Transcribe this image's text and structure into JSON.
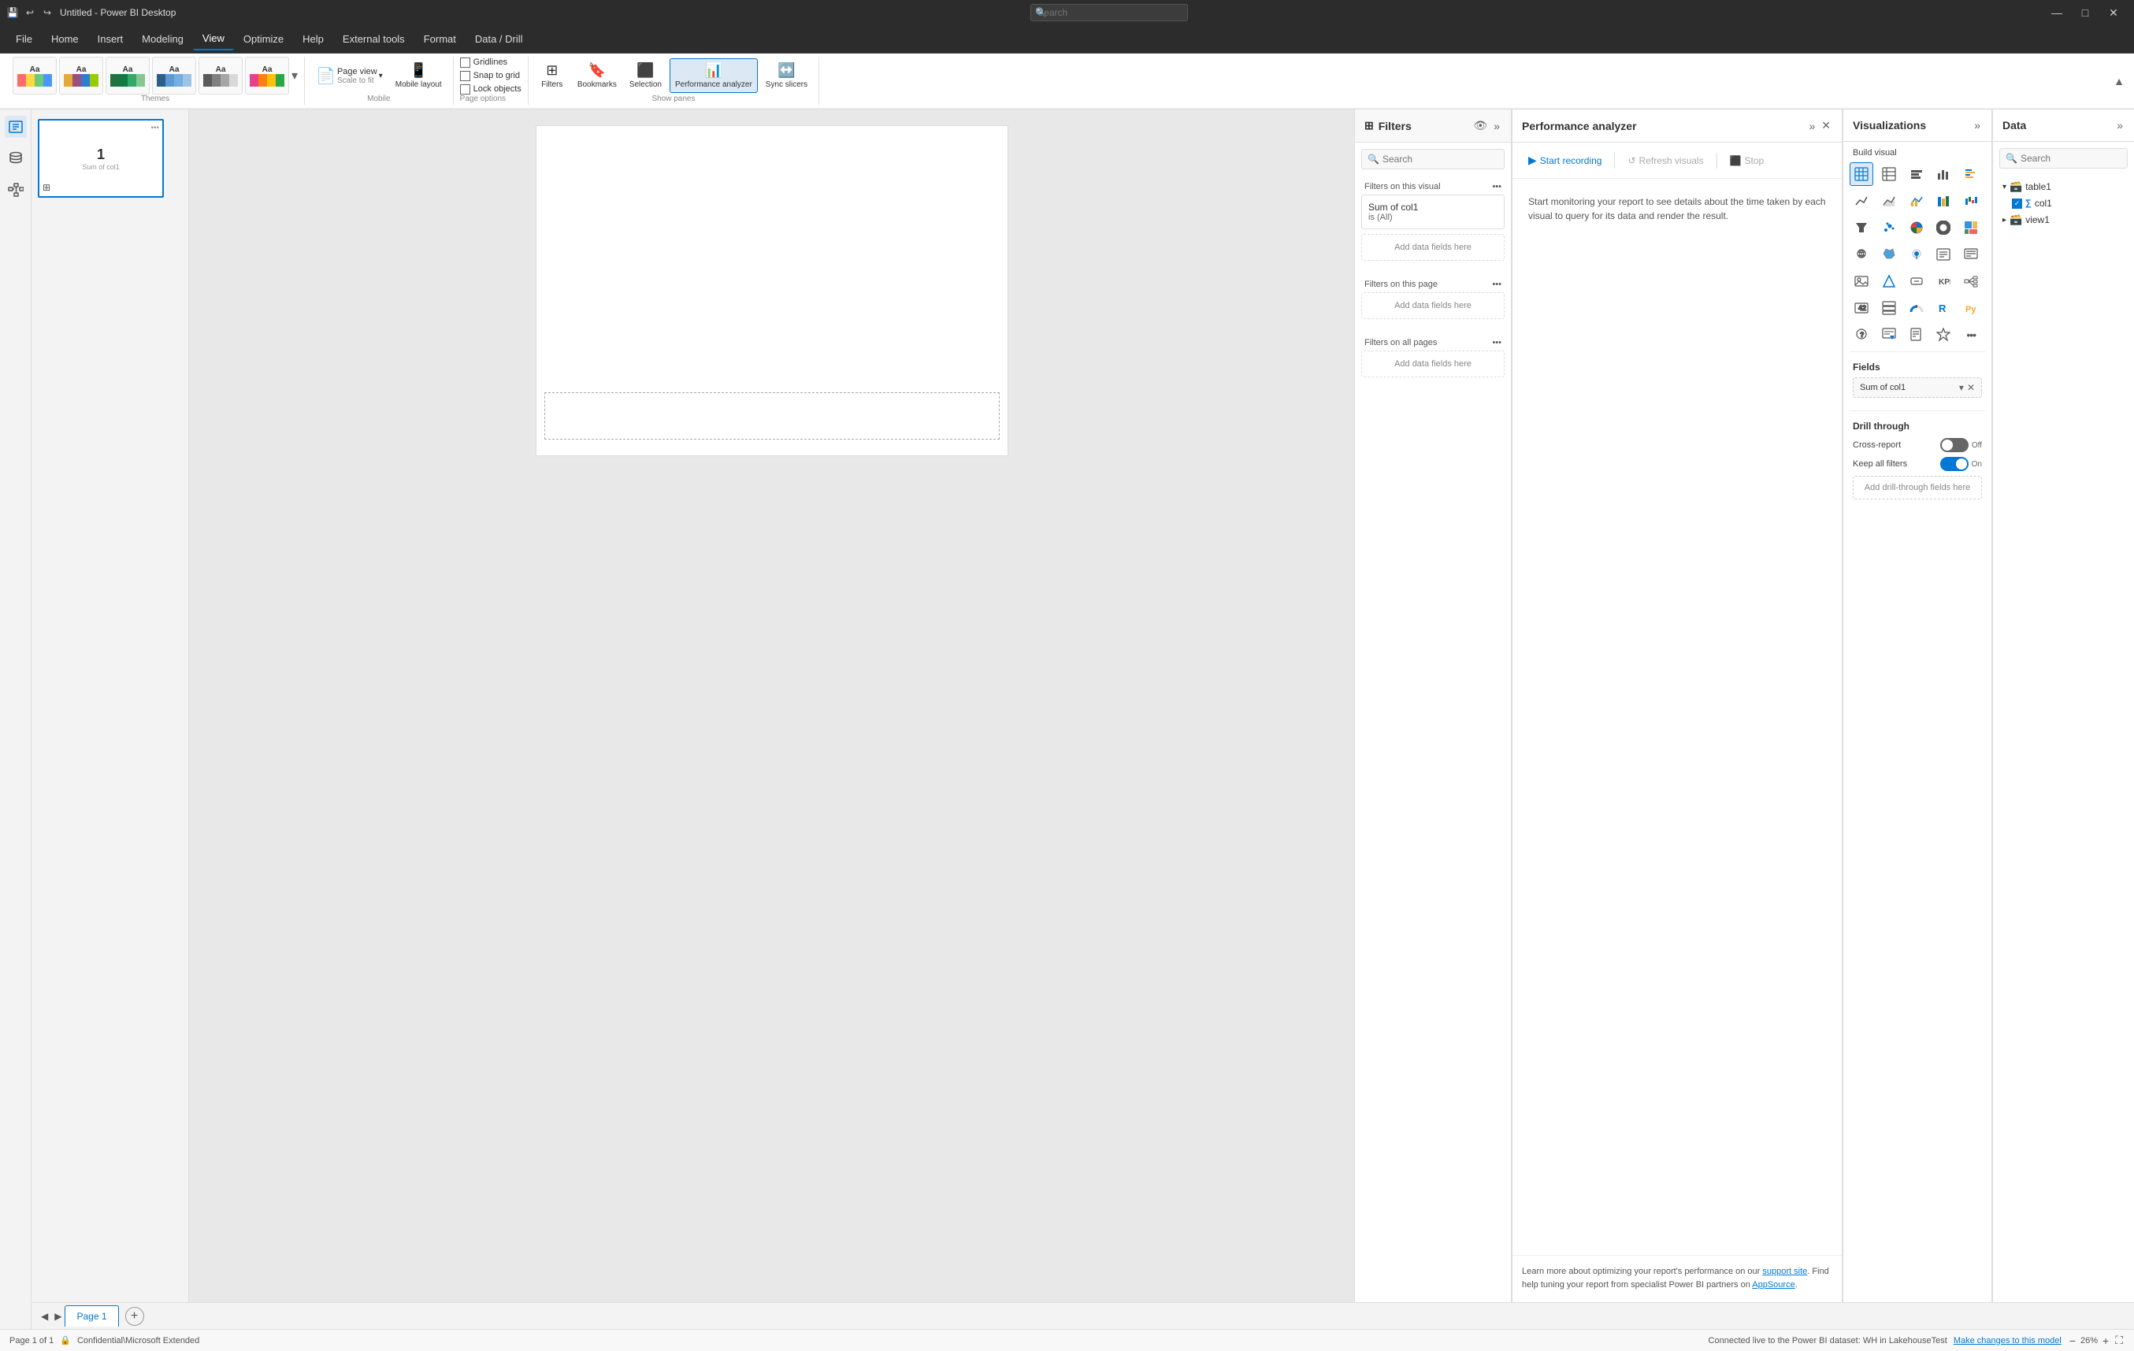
{
  "titleBar": {
    "saveIcon": "💾",
    "undoIcon": "↩",
    "redoIcon": "↪",
    "title": "Untitled - Power BI Desktop",
    "searchPlaceholder": "Search",
    "minimizeIcon": "—",
    "maximizeIcon": "□",
    "closeIcon": "✕"
  },
  "menuBar": {
    "items": [
      {
        "label": "File",
        "active": false
      },
      {
        "label": "Home",
        "active": false
      },
      {
        "label": "Insert",
        "active": false
      },
      {
        "label": "Modeling",
        "active": false
      },
      {
        "label": "View",
        "active": true
      },
      {
        "label": "Optimize",
        "active": false
      },
      {
        "label": "Help",
        "active": false
      },
      {
        "label": "External tools",
        "active": false
      },
      {
        "label": "Format",
        "active": false
      },
      {
        "label": "Data / Drill",
        "active": false
      }
    ]
  },
  "ribbon": {
    "themes": {
      "label": "Themes",
      "items": [
        "Aa",
        "Aa",
        "Aa",
        "Aa",
        "Aa",
        "Aa"
      ]
    },
    "pageView": {
      "label": "Page\nview",
      "icon": "📄",
      "sublabel": "Scale to fit"
    },
    "mobileLayout": {
      "label": "Mobile\nlayout",
      "icon": "📱",
      "sublabel": "Mobile"
    },
    "pageOptions": {
      "checkboxes": [
        "Gridlines",
        "Snap to grid",
        "Lock objects"
      ],
      "label": "Page options"
    },
    "filters": {
      "label": "Filters",
      "icon": "🔽"
    },
    "bookmarks": {
      "label": "Bookmarks",
      "icon": "🔖"
    },
    "selection": {
      "label": "Selection",
      "icon": "⬛"
    },
    "performanceAnalyzer": {
      "label": "Performance\nanalyzer",
      "icon": "📊",
      "active": true
    },
    "syncSlicers": {
      "label": "Sync\nslicers",
      "icon": "↔️"
    },
    "showPanes": {
      "label": "Show panes"
    }
  },
  "filtersPanel": {
    "title": "Filters",
    "searchPlaceholder": "Search",
    "sections": [
      {
        "label": "Filters on this visual",
        "filters": [
          {
            "name": "Sum of col1",
            "value": "is (All)"
          }
        ],
        "addLabel": "Add data fields here"
      },
      {
        "label": "Filters on this page",
        "filters": [],
        "addLabel": "Add data fields here"
      },
      {
        "label": "Filters on all pages",
        "filters": [],
        "addLabel": "Add data fields here"
      }
    ]
  },
  "performanceAnalyzer": {
    "title": "Performance analyzer",
    "startRecordingLabel": "Start recording",
    "refreshVisualsLabel": "Refresh visuals",
    "stopLabel": "Stop",
    "description": "Start monitoring your report to see details about the time taken by each visual to query for its data and render the result.",
    "footerText": "Learn more about optimizing your report's performance on our ",
    "footerLink1": "support site",
    "footerMiddle": ". Find help tuning your report from specialist Power BI partners on ",
    "footerLink2": "AppSource",
    "footerEnd": "."
  },
  "visualizations": {
    "title": "Visualizations",
    "buildVisualLabel": "Build visual",
    "icons": [
      "📊",
      "📈",
      "📉",
      "🔢",
      "📋",
      "🗺️",
      "⛰️",
      "〰️",
      "📶",
      "🎯",
      "🔵",
      "🔺",
      "💹",
      "🍩",
      "🎴",
      "🔘",
      "⚡",
      "🌀",
      "📝",
      "📃",
      "🖼️",
      "🔷",
      "🔲",
      "🏆",
      "📊",
      "⬜",
      "🔶",
      "🌐",
      "🔴",
      "🐍",
      "🎰",
      "⊞",
      "⬛",
      "🔑",
      "▓"
    ],
    "fieldsLabel": "Fields",
    "fields": [
      {
        "name": "Sum of col1",
        "hasDropdown": true,
        "hasX": true
      }
    ],
    "drillThrough": {
      "label": "Drill through",
      "rows": [
        {
          "label": "Cross-report",
          "toggleState": "off",
          "toggleLabel": "Off"
        },
        {
          "label": "Keep all filters",
          "toggleState": "on",
          "toggleLabel": "On"
        }
      ],
      "addLabel": "Add drill-through fields here"
    }
  },
  "dataPanel": {
    "title": "Data",
    "searchPlaceholder": "Search",
    "tables": [
      {
        "name": "table1",
        "expanded": true,
        "icon": "🗃️",
        "fields": [
          {
            "name": "col1",
            "type": "measure",
            "checked": true,
            "icon": "∑"
          }
        ]
      },
      {
        "name": "view1",
        "expanded": false,
        "icon": "🗃️",
        "fields": []
      }
    ]
  },
  "pageTab": {
    "label": "Page 1",
    "addLabel": "+"
  },
  "statusBar": {
    "pageInfo": "Page 1 of 1",
    "lockIcon": "🔒",
    "classification": "Confidential\\Microsoft Extended",
    "connectionStatus": "Connected live to the Power BI dataset: WH in LakehouseTest",
    "makeChangesLabel": "Make changes to this model",
    "zoomLevel": "26%"
  },
  "pageThumbnail": {
    "pageNumber": "1",
    "subLabel": "Sum of col1"
  }
}
